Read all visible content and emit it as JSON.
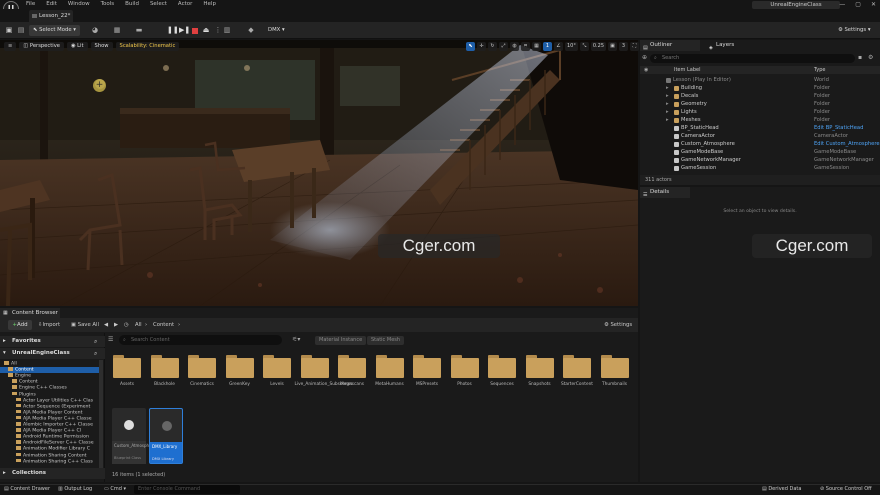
{
  "title_bar": {
    "logo": "U",
    "menu": [
      "File",
      "Edit",
      "Window",
      "Tools",
      "Build",
      "Select",
      "Actor",
      "Help"
    ],
    "app_title": "UnrealEngineClass",
    "level_tab": "Lesson_22*",
    "window_controls": {
      "minimize": "—",
      "maximize": "▢",
      "close": "✕"
    }
  },
  "toolbar": {
    "select_mode": "Select Mode",
    "dmx": "DMX",
    "settings": "Settings",
    "play_icons": [
      "pause-icon",
      "step-icon",
      "stop-icon",
      "eject-icon"
    ],
    "colors": {
      "stop": "#e04040",
      "accent": "#1e5ea8"
    }
  },
  "viewport": {
    "perspective": "Perspective",
    "lit": "Lit",
    "show": "Show",
    "scalability": "Scalability: Cinematic",
    "grid_snap": "10",
    "rotation_snap": "10°",
    "scale_snap": "0.25",
    "camera_speed": "3",
    "grid_number": "1"
  },
  "watermarks": {
    "viewport": "Cger.com",
    "right": "Cger.com"
  },
  "outliner": {
    "tab": "Outliner",
    "layers_tab": "Layers",
    "search_placeholder": "Search",
    "col_label": "Item Label",
    "col_type": "Type",
    "rows": [
      {
        "name": "Lesson (Play In Editor)",
        "type": "World",
        "indent": 0,
        "dim": true
      },
      {
        "name": "Building",
        "type": "Folder",
        "indent": 1
      },
      {
        "name": "Decals",
        "type": "Folder",
        "indent": 1
      },
      {
        "name": "Geometry",
        "type": "Folder",
        "indent": 1
      },
      {
        "name": "Lights",
        "type": "Folder",
        "indent": 1
      },
      {
        "name": "Meshes",
        "type": "Folder",
        "indent": 1
      },
      {
        "name": "BP_StaticHead",
        "type": "Edit BP_StaticHead",
        "indent": 1,
        "link": true
      },
      {
        "name": "CameraActor",
        "type": "CameraActor",
        "indent": 1
      },
      {
        "name": "Custom_Atmosphere",
        "type": "Edit Custom_Atmosphere",
        "indent": 1,
        "link": true
      },
      {
        "name": "GameModeBase",
        "type": "GameModeBase",
        "indent": 1
      },
      {
        "name": "GameNetworkManager",
        "type": "GameNetworkManager",
        "indent": 1
      },
      {
        "name": "GameSession",
        "type": "GameSession",
        "indent": 1
      }
    ],
    "count": "311 actors"
  },
  "details": {
    "tab": "Details",
    "empty_text": "Select an object to view details."
  },
  "content_browser": {
    "tab": "Content Browser",
    "add": "Add",
    "import": "Import",
    "save_all": "Save All",
    "breadcrumb": [
      "All",
      "Content"
    ],
    "settings": "Settings",
    "search_placeholder": "Search Content",
    "filters": [
      "Material Instance",
      "Static Mesh"
    ],
    "favorites": "Favorites",
    "project": "UnrealEngineClass",
    "collections": "Collections",
    "tree": [
      {
        "label": "All",
        "indent": 0
      },
      {
        "label": "Content",
        "indent": 1,
        "selected": true
      },
      {
        "label": "Engine",
        "indent": 1
      },
      {
        "label": "Content",
        "indent": 2
      },
      {
        "label": "Engine C++ Classes",
        "indent": 2
      },
      {
        "label": "Plugins",
        "indent": 2
      },
      {
        "label": "Actor Layer Utilities C++ Clas",
        "indent": 3
      },
      {
        "label": "Actor Sequence (Experiment",
        "indent": 3
      },
      {
        "label": "AJA Media Player Content",
        "indent": 3
      },
      {
        "label": "AJA Media Player C++ Classe",
        "indent": 3
      },
      {
        "label": "Alembic Importer C++ Classe",
        "indent": 3
      },
      {
        "label": "AJA Media Player C++ Cl",
        "indent": 3
      },
      {
        "label": "Android Runtime Permission",
        "indent": 3
      },
      {
        "label": "AndroidFileServer C++ Classe",
        "indent": 3
      },
      {
        "label": "Animation Modifier Library C",
        "indent": 3
      },
      {
        "label": "Animation Sharing Content",
        "indent": 3
      },
      {
        "label": "Animation Sharing C++ Class",
        "indent": 3
      }
    ],
    "folders": [
      "Assets",
      "Blackhole",
      "Cinematics",
      "GreenKey",
      "Levels",
      "Live_Animation_Subscenes",
      "Megascans",
      "MetaHumans",
      "MSPresets",
      "Photos",
      "Sequences",
      "Snapshots",
      "StarterContent",
      "Thumbnails"
    ],
    "assets": [
      {
        "label": "Custom_Atmosphere",
        "sub": "Blueprint Class",
        "selected": false
      },
      {
        "label": "DMX_Library",
        "sub": "DMX Library",
        "selected": true
      }
    ],
    "items_text": "16 items (1 selected)"
  },
  "status_bar": {
    "content_drawer": "Content Drawer",
    "output_log": "Output Log",
    "cmd": "Cmd",
    "cmd_placeholder": "Enter Console Command",
    "derived_data": "Derived Data",
    "source_control": "Source Control Off"
  }
}
